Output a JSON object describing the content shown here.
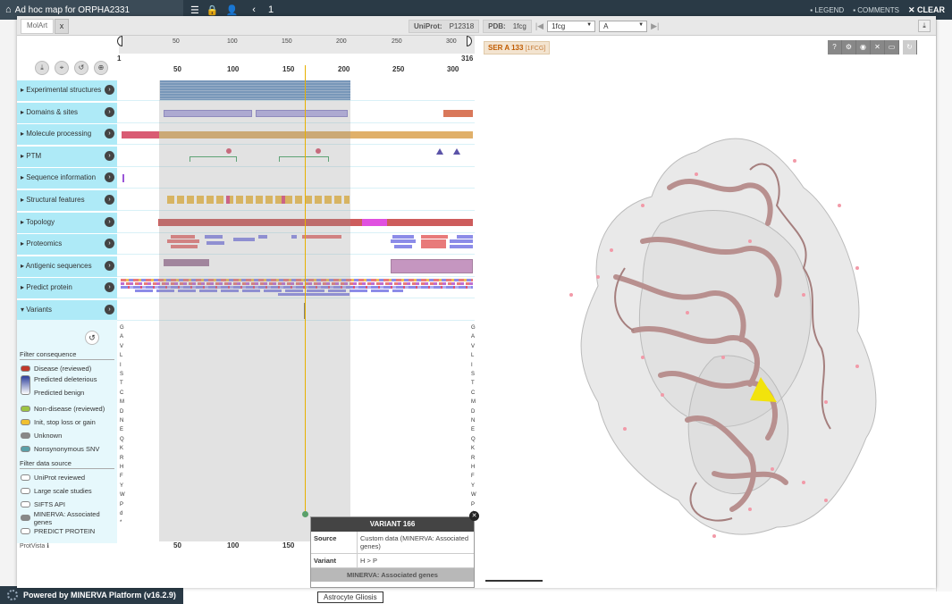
{
  "topbar": {
    "title": "Ad hoc map for ORPHA2331",
    "page": "1",
    "legend": "LEGEND",
    "comments": "COMMENTS",
    "clear": "CLEAR"
  },
  "footer": {
    "powered": "Powered by MINERVA Platform (v16.2.9)"
  },
  "background": {
    "node_label": "Astrocyte Gliosis"
  },
  "tabs": {
    "molart": "MolArt",
    "close": "x"
  },
  "protvista": {
    "range_start": "1",
    "range_end": "316",
    "ruler_ticks": [
      "50",
      "100",
      "150",
      "200",
      "250",
      "300"
    ],
    "axis_ticks": [
      "50",
      "100",
      "150",
      "200",
      "250",
      "300"
    ],
    "bottom_ticks": [
      "50",
      "100",
      "150"
    ],
    "footer": "ProtVista",
    "tracks": [
      {
        "label": "Experimental structures"
      },
      {
        "label": "Domains & sites"
      },
      {
        "label": "Molecule processing"
      },
      {
        "label": "PTM"
      },
      {
        "label": "Sequence information"
      },
      {
        "label": "Structural features"
      },
      {
        "label": "Topology"
      },
      {
        "label": "Proteomics"
      },
      {
        "label": "Antigenic sequences"
      },
      {
        "label": "Predict protein"
      },
      {
        "label": "Variants"
      }
    ],
    "amino_acids": [
      "G",
      "A",
      "V",
      "L",
      "I",
      "S",
      "T",
      "C",
      "M",
      "D",
      "N",
      "E",
      "Q",
      "K",
      "R",
      "H",
      "F",
      "Y",
      "W",
      "P",
      "d",
      "*"
    ]
  },
  "filters": {
    "consequence_title": "Filter consequence",
    "consequence": [
      {
        "label": "Disease (reviewed)",
        "color": "#c0392b"
      },
      {
        "label": "Predicted deleterious",
        "color": "#2c3e9a"
      },
      {
        "label": "Predicted benign",
        "color": "#ffffff"
      },
      {
        "label": "Non-disease (reviewed)",
        "color": "#9dc443"
      },
      {
        "label": "Init, stop loss or gain",
        "color": "#f0c030"
      },
      {
        "label": "Unknown",
        "color": "#888888"
      },
      {
        "label": "Nonsynonymous SNV",
        "color": "#5aa0a8"
      }
    ],
    "source_title": "Filter data source",
    "sources": [
      {
        "label": "UniProt reviewed",
        "color": "#ffffff"
      },
      {
        "label": "Large scale studies",
        "color": "#ffffff"
      },
      {
        "label": "SIFTS API",
        "color": "#ffffff"
      },
      {
        "label": "MINERVA: Associated genes",
        "color": "#888888"
      },
      {
        "label": "PREDICT PROTEIN",
        "color": "#ffffff"
      }
    ]
  },
  "popup": {
    "title": "VARIANT 166",
    "source_key": "Source",
    "source_val": "Custom data (MINERVA: Associated genes)",
    "variant_key": "Variant",
    "variant_val": "H > P",
    "footer": "MINERVA: Associated genes"
  },
  "mol": {
    "uniprot_label": "UniProt:",
    "uniprot_id": "P12318",
    "pdb_label": "PDB:",
    "pdb_id": "1fcg",
    "structure": "1fcg",
    "chain": "A",
    "residue": "SER A 133",
    "residue_pdb": "[1FCG]"
  }
}
